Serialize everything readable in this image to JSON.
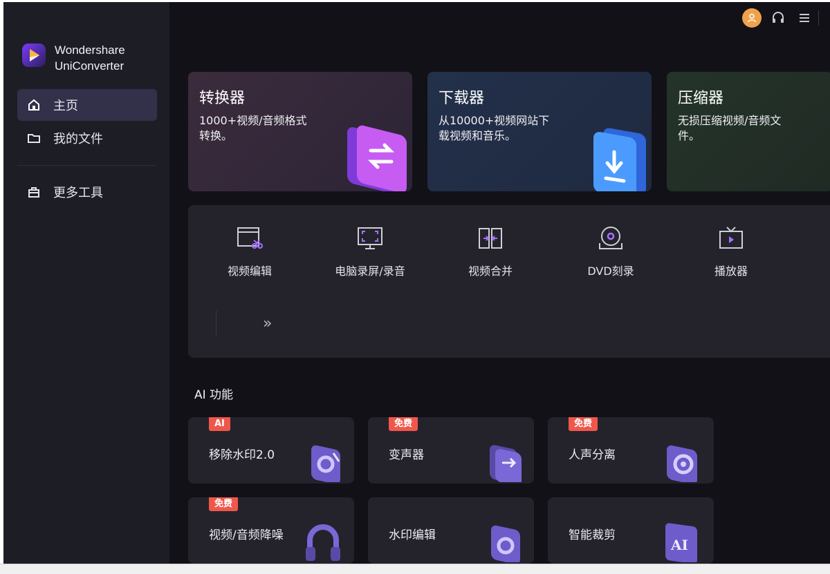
{
  "app": {
    "name_line1": "Wondershare",
    "name_line2": "UniConverter"
  },
  "sidebar": {
    "items": [
      {
        "label": "主页",
        "icon": "home-icon",
        "active": true
      },
      {
        "label": "我的文件",
        "icon": "folder-icon",
        "active": false
      },
      {
        "label": "更多工具",
        "icon": "toolbox-icon",
        "active": false
      }
    ]
  },
  "header": {
    "icons": [
      "user-avatar-icon",
      "headset-support-icon",
      "menu-icon"
    ]
  },
  "features": [
    {
      "title": "转换器",
      "desc": "1000+视频/音频格式转换。",
      "icon": "convert-icon"
    },
    {
      "title": "下载器",
      "desc": "从10000+视频网站下载视频和音乐。",
      "icon": "download-icon"
    },
    {
      "title": "压缩器",
      "desc": "无损压缩视频/音频文件。",
      "icon": "compress-icon"
    }
  ],
  "tools": {
    "items": [
      {
        "label": "视频编辑",
        "icon": "video-edit-icon"
      },
      {
        "label": "电脑录屏/录音",
        "icon": "screen-record-icon"
      },
      {
        "label": "视频合并",
        "icon": "merge-icon"
      },
      {
        "label": "DVD刻录",
        "icon": "dvd-burn-icon"
      },
      {
        "label": "播放器",
        "icon": "player-icon"
      }
    ],
    "more_glyph": "»"
  },
  "ai": {
    "heading": "AI 功能",
    "cards": [
      {
        "label": "移除水印2.0",
        "badge": "AI",
        "icon": "remove-watermark-icon"
      },
      {
        "label": "变声器",
        "badge": "免费",
        "icon": "voice-changer-icon"
      },
      {
        "label": "人声分离",
        "badge": "免费",
        "icon": "vocal-separate-icon"
      },
      {
        "label": "视频/音频降噪",
        "badge": "免费",
        "icon": "noise-reduction-icon"
      },
      {
        "label": "水印编辑",
        "badge": "",
        "icon": "watermark-edit-icon"
      },
      {
        "label": "智能裁剪",
        "badge": "",
        "icon": "smart-crop-icon",
        "art_text": "AI"
      }
    ]
  },
  "colors": {
    "background": "#121117",
    "sidebar": "#1d1d25",
    "panel": "#24232c",
    "active_nav": "#33304a",
    "accent_purple": "#b35cff",
    "accent_blue": "#3b8cff",
    "badge_red": "#f0574b",
    "avatar": "#f0a14a"
  }
}
